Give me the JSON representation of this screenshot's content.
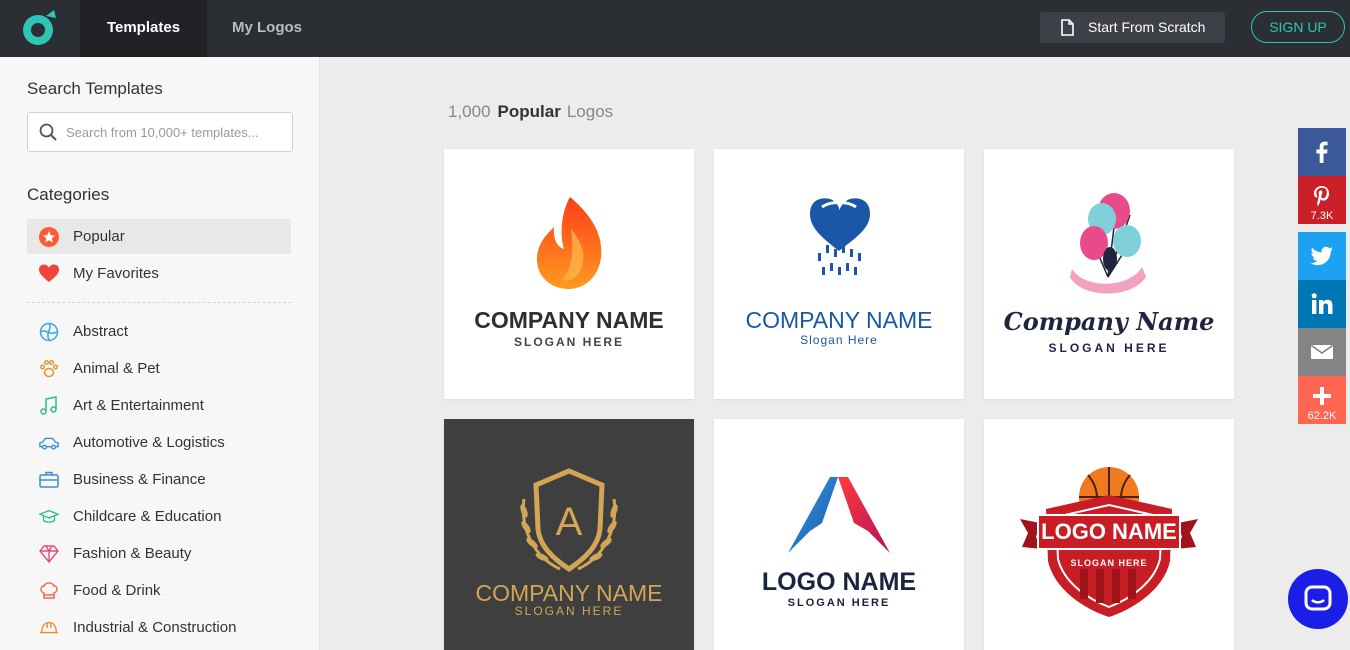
{
  "header": {
    "tabs": [
      {
        "label": "Templates",
        "active": true
      },
      {
        "label": "My Logos",
        "active": false
      }
    ],
    "scratch_label": "Start From Scratch",
    "signup_label": "SIGN UP",
    "accent": "#2ec4b6"
  },
  "sidebar": {
    "search_title": "Search Templates",
    "search_placeholder": "Search from 10,000+ templates...",
    "categories_title": "Categories",
    "quick": [
      {
        "label": "Popular",
        "icon": "star-icon",
        "active": true
      },
      {
        "label": "My Favorites",
        "icon": "heart-icon",
        "active": false
      }
    ],
    "categories": [
      {
        "label": "Abstract",
        "icon": "abstract-icon"
      },
      {
        "label": "Animal & Pet",
        "icon": "paw-icon"
      },
      {
        "label": "Art & Entertainment",
        "icon": "music-note-icon"
      },
      {
        "label": "Automotive & Logistics",
        "icon": "car-icon"
      },
      {
        "label": "Business & Finance",
        "icon": "briefcase-icon"
      },
      {
        "label": "Childcare & Education",
        "icon": "graduation-cap-icon"
      },
      {
        "label": "Fashion & Beauty",
        "icon": "diamond-icon"
      },
      {
        "label": "Food & Drink",
        "icon": "chef-hat-icon"
      },
      {
        "label": "Industrial & Construction",
        "icon": "hard-hat-icon"
      }
    ]
  },
  "main": {
    "count": "1,000",
    "filter": "Popular",
    "suffix": "Logos",
    "templates": [
      {
        "name": "COMPANY NAME",
        "slogan": "SLOGAN HERE",
        "symbol": "flame-logo"
      },
      {
        "name": "COMPANY NAME",
        "slogan": "Slogan Here",
        "symbol": "heart-rain-logo"
      },
      {
        "name": "Company Name",
        "slogan": "SLOGAN HERE",
        "symbol": "balloons-logo"
      },
      {
        "name": "COMPANY NAME",
        "slogan": "SLOGAN HERE",
        "symbol": "shield-letter-logo",
        "letter": "A"
      },
      {
        "name": "LOGO NAME",
        "slogan": "SLOGAN HERE",
        "symbol": "a-peak-logo"
      },
      {
        "name": "LOGO NAME",
        "slogan": "SLOGAN HERE",
        "symbol": "basketball-badge-logo"
      }
    ]
  },
  "share": [
    {
      "network": "Facebook",
      "icon": "facebook-icon",
      "color": "#3b5998",
      "count": ""
    },
    {
      "network": "Pinterest",
      "icon": "pinterest-icon",
      "color": "#cb2027",
      "count": "7.3K"
    },
    {
      "network": "Twitter",
      "icon": "twitter-icon",
      "color": "#1da1f2",
      "count": ""
    },
    {
      "network": "LinkedIn",
      "icon": "linkedin-icon",
      "color": "#0077b5",
      "count": ""
    },
    {
      "network": "Email",
      "icon": "email-icon",
      "color": "#848484",
      "count": ""
    },
    {
      "network": "More",
      "icon": "plus-icon",
      "color": "#ff6550",
      "count": "62.2K"
    }
  ]
}
